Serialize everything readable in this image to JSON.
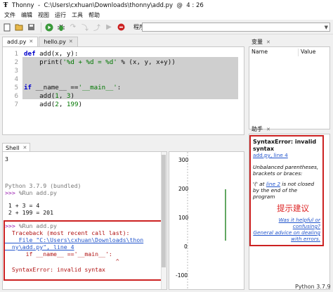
{
  "window": {
    "title": "Thonny  -  C:\\Users\\cxhuan\\Downloads\\thonny\\add.py  @  4 : 26"
  },
  "menu": [
    "文件",
    "编辑",
    "视图",
    "运行",
    "工具",
    "帮助"
  ],
  "toolbar": {
    "args_label": "程序参数:",
    "args_value": ""
  },
  "editor": {
    "tabs": [
      {
        "label": "add.py"
      },
      {
        "label": "hello.py"
      }
    ],
    "lines": [
      {
        "n": "1",
        "code": "def add(x, y):"
      },
      {
        "n": "2",
        "code": "    print('%d + %d = %d' % (x, y, x+y))"
      },
      {
        "n": "3",
        "code": ""
      },
      {
        "n": "4",
        "code": ""
      },
      {
        "n": "5",
        "code": "if __name__ =='__main__':"
      },
      {
        "n": "6",
        "code": "    add(1, 3)"
      },
      {
        "n": "7",
        "code": "    add(2, 199)"
      }
    ]
  },
  "variables": {
    "tab": "变量",
    "col_name": "Name",
    "col_value": "Value"
  },
  "assistant": {
    "tab": "助手",
    "error_title": "SyntaxError: invalid syntax",
    "location_link": "add.py, line 4",
    "unbalanced": "Unbalanced parentheses, brackets or braces:",
    "detail_pre": "'(' at ",
    "detail_link": "line 2",
    "detail_post": " is not closed by the end of the program",
    "helpful": "Was it helpful or confusing?",
    "general": "General advice on dealing with errors.",
    "annotation": "提示建议"
  },
  "shell": {
    "tab": "Shell",
    "lines": [
      {
        "t": "3",
        "cls": ""
      },
      {
        "t": "",
        "cls": ""
      },
      {
        "t": "Python 3.7.9 (bundled)",
        "cls": "gray"
      },
      {
        "t": ">>> %Run add.py",
        "cls": "run"
      },
      {
        "t": "",
        "cls": ""
      },
      {
        "t": " 1 + 3 = 4",
        "cls": ""
      },
      {
        "t": " 2 + 199 = 201",
        "cls": ""
      },
      {
        "t": ">>> %Run add.py",
        "cls": "run"
      },
      {
        "t": "  Traceback (most recent call last):",
        "cls": "errtxt"
      },
      {
        "t": "    File \"C:\\Users\\cxhuan\\Downloads\\thon",
        "cls": "errlink"
      },
      {
        "t": "  ny\\add.py\", line 4",
        "cls": "errlink"
      },
      {
        "t": "      if __name__ =='__main__':",
        "cls": "errtxt"
      },
      {
        "t": "                                ^",
        "cls": "errtxt"
      },
      {
        "t": "  SyntaxError: invalid syntax",
        "cls": "errtxt"
      }
    ]
  },
  "plotter": {
    "ticks": [
      "300",
      "200",
      "100",
      "0",
      "-100"
    ],
    "series_color": "#2e8b2e"
  },
  "status": {
    "version": "Python 3.7.9"
  }
}
